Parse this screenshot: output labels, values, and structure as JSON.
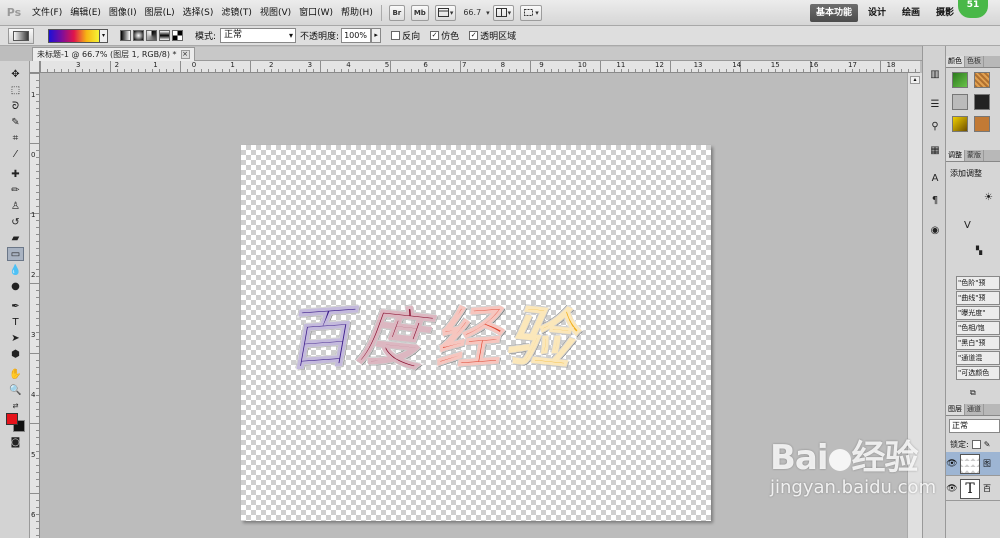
{
  "app": {
    "logo": "Ps",
    "menus": [
      "文件(F)",
      "编辑(E)",
      "图像(I)",
      "图层(L)",
      "选择(S)",
      "滤镜(T)",
      "视图(V)",
      "窗口(W)",
      "帮助(H)"
    ],
    "toolbar_buttons": [
      "Br",
      "Mb"
    ],
    "zoom": "66.7",
    "workspaces": [
      "基本功能",
      "设计",
      "绘画",
      "摄影"
    ],
    "active_workspace": "基本功能",
    "badge": "51"
  },
  "options": {
    "mode_label": "模式:",
    "mode_value": "正常",
    "opacity_label": "不透明度:",
    "opacity_value": "100%",
    "reverse_label": "反向",
    "dither_label": "仿色",
    "transparency_label": "透明区域",
    "dither_checked": "✓",
    "transparency_checked": "✓",
    "gradient_colors": [
      "#1c0fd8",
      "#7a0d9e",
      "#e0154b",
      "#f7b513",
      "#f5f536"
    ]
  },
  "document": {
    "tab_title": "未标题-1 @ 66.7% (图层 1, RGB/8) *",
    "close": "×"
  },
  "rulers": {
    "h": [
      "3",
      "2",
      "1",
      "0",
      "1",
      "2",
      "3",
      "4",
      "5",
      "6",
      "7",
      "8",
      "9",
      "10",
      "11",
      "12",
      "13",
      "14",
      "15",
      "16",
      "17",
      "18",
      "19"
    ],
    "v": [
      "1",
      "0",
      "1",
      "2",
      "3",
      "4",
      "5",
      "6"
    ]
  },
  "canvas": {
    "chars": [
      "百",
      "度",
      "经",
      "验"
    ],
    "char_colors": [
      "#3a1a8a",
      "#8a1030",
      "#e0402a",
      "#f2b01a"
    ]
  },
  "colors": {
    "foreground": "#e5131b",
    "background": "#111111"
  },
  "panels": {
    "tab_styles": [
      "颜色",
      "色板"
    ],
    "tab_adjust": [
      "调整",
      "蒙版"
    ],
    "adjust_title": "添加调整",
    "presets": [
      "\"色阶\"预",
      "\"曲线\"预",
      "\"曝光度\"",
      "\"色相/饱",
      "\"黑白\"预",
      "\"通道混",
      "\"可选颜色"
    ],
    "tab_layers": [
      "图层",
      "通道"
    ],
    "blend_mode": "正常",
    "lock_label": "锁定:",
    "layers": [
      {
        "name": "图",
        "type": "pattern"
      },
      {
        "name": "百",
        "type": "text",
        "glyph": "T"
      }
    ]
  },
  "watermark": {
    "logo_left": "Bai",
    "logo_right": "经验",
    "url": "jingyan.baidu.com"
  }
}
